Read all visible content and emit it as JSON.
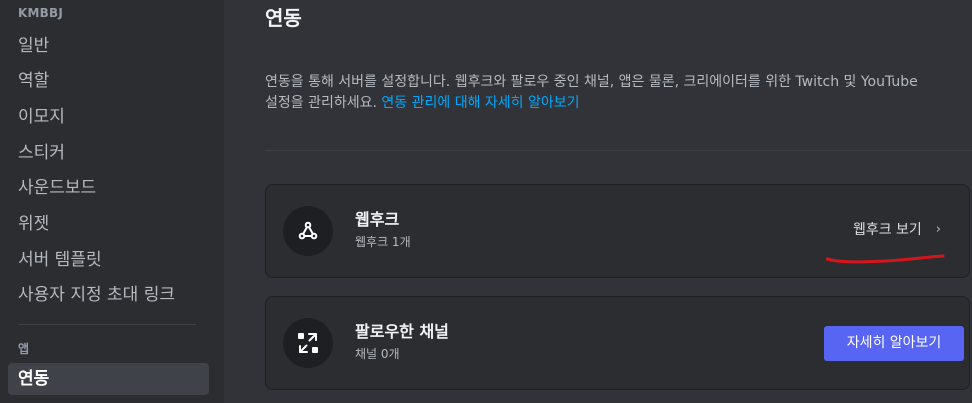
{
  "sidebar": {
    "server_name": "KMBBJ",
    "items": [
      {
        "label": "일반"
      },
      {
        "label": "역할"
      },
      {
        "label": "이모지"
      },
      {
        "label": "스티커"
      },
      {
        "label": "사운드보드"
      },
      {
        "label": "위젯"
      },
      {
        "label": "서버 템플릿"
      },
      {
        "label": "사용자 지정 초대 링크"
      }
    ],
    "apps_header": "앱",
    "apps_items": [
      {
        "label": "연동",
        "active": true
      }
    ]
  },
  "main": {
    "title": "연동",
    "description": "연동을 통해 서버를 설정합니다. 웹후크와 팔로우 중인 채널, 앱은 물론, 크리에이터를 위한 Twitch 및 YouTube 설정을 관리하세요.",
    "description_link": "연동 관리에 대해 자세히 알아보기",
    "cards": {
      "webhooks": {
        "icon": "webhook-icon",
        "title": "웹후크",
        "subtitle": "웹후크 1개",
        "action_label": "웹후크 보기",
        "action_chevron": "›"
      },
      "followed_channels": {
        "icon": "follow-channel-icon",
        "title": "팔로우한 채널",
        "subtitle": "채널 0개",
        "action_label": "자세히 알아보기"
      }
    }
  },
  "colors": {
    "background": "#313338",
    "sidebar": "#2b2d31",
    "active_item": "#404249",
    "link": "#00a8fc",
    "brand": "#5865f2",
    "annotation_red": "#d4161c"
  }
}
